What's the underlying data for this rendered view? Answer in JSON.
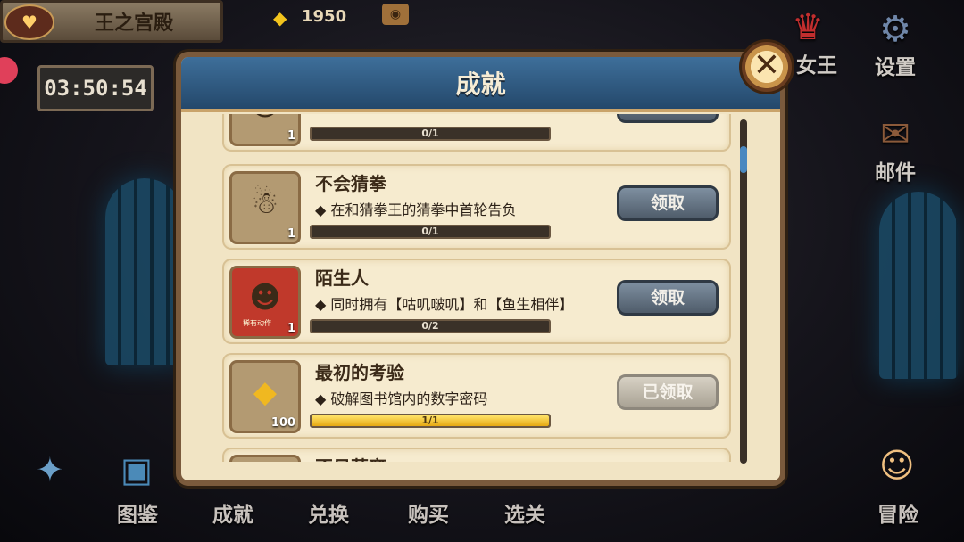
{
  "header": {
    "location_title": "王之宫殿",
    "timer": "03:50:54",
    "gems": "1950"
  },
  "side_menu": {
    "king_label": "女王",
    "settings_label": "设置",
    "mail_label": "邮件"
  },
  "bottom_menu": {
    "items": [
      {
        "label": "图鉴"
      },
      {
        "label": "成就"
      },
      {
        "label": "兑换"
      },
      {
        "label": "购买"
      },
      {
        "label": "选关"
      }
    ],
    "adventure_label": "冒险"
  },
  "modal": {
    "title": "成就",
    "achievements": [
      {
        "title": "",
        "desc": "",
        "progress": "0/1",
        "fill": 0,
        "qty": "1",
        "button": ""
      },
      {
        "title": "不会猜拳",
        "desc": "◆ 在和猜拳王的猜拳中首轮告负",
        "progress": "0/1",
        "fill": 0,
        "qty": "1",
        "button": "领取"
      },
      {
        "title": "陌生人",
        "desc": "◆ 同时拥有【咕叽啵叽】和【鱼生相伴】",
        "progress": "0/2",
        "fill": 0,
        "qty": "1",
        "button": "领取",
        "art_text": "稀有动作"
      },
      {
        "title": "最初的考验",
        "desc": "◆ 破解图书馆内的数字密码",
        "progress": "1/1",
        "fill": 1,
        "qty": "100",
        "button": "已领取"
      },
      {
        "title": "不日莫离",
        "desc": "",
        "progress": "",
        "fill": 0,
        "qty": "",
        "button": ""
      }
    ]
  },
  "colors": {
    "modal_header": "#2f5b84",
    "progress_fill": "#f0c020",
    "claim_button": "#5e6c7a"
  }
}
